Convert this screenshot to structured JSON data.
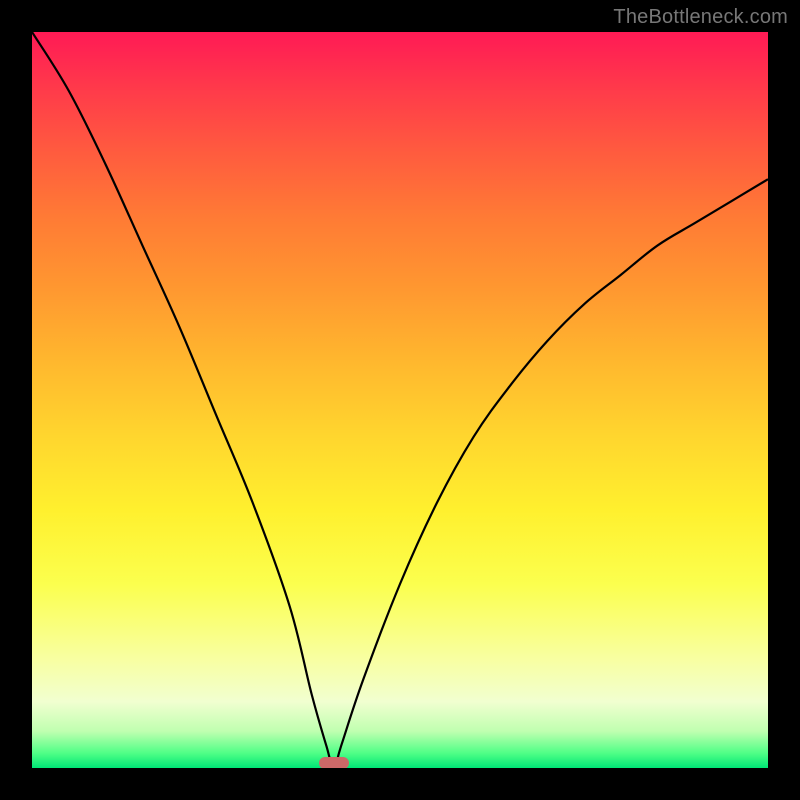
{
  "attribution": "TheBottleneck.com",
  "chart_data": {
    "type": "line",
    "title": "",
    "xlabel": "",
    "ylabel": "",
    "xlim": [
      0,
      100
    ],
    "ylim": [
      0,
      100
    ],
    "categories": [
      0,
      5,
      10,
      15,
      20,
      25,
      30,
      35,
      38,
      40,
      41,
      42,
      45,
      50,
      55,
      60,
      65,
      70,
      75,
      80,
      85,
      90,
      95,
      100
    ],
    "values": [
      100,
      92,
      82,
      71,
      60,
      48,
      36,
      22,
      10,
      3,
      0,
      3,
      12,
      25,
      36,
      45,
      52,
      58,
      63,
      67,
      71,
      74,
      77,
      80
    ],
    "marker": {
      "x": 41,
      "y": 0
    },
    "gradient_stops": [
      {
        "pos": 0,
        "color": "#ff1a55"
      },
      {
        "pos": 25,
        "color": "#ff7a35"
      },
      {
        "pos": 55,
        "color": "#ffd62e"
      },
      {
        "pos": 85,
        "color": "#f8ffa0"
      },
      {
        "pos": 100,
        "color": "#00e676"
      }
    ]
  }
}
